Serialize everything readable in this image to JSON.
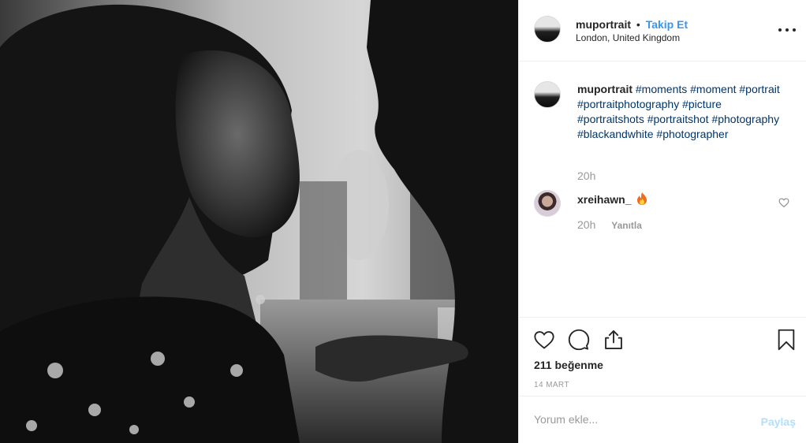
{
  "post": {
    "username": "muportrait",
    "separator": "•",
    "follow_label": "Takip Et",
    "location": "London, United Kingdom",
    "more_options_icon": "more-horizontal-icon"
  },
  "photo": {
    "description_icon": "photo"
  },
  "caption": {
    "username": "muportrait",
    "hashtags": [
      "#moments",
      "#moment",
      "#portrait",
      "#portraitphotography",
      "#picture",
      "#portraitshots",
      "#portraitshot",
      "#photography",
      "#blackandwhite",
      "#photographer"
    ],
    "time": "20h"
  },
  "comments": [
    {
      "username": "xreihawn_",
      "emoji": "fire",
      "time": "20h",
      "reply_label": "Yanıtla"
    }
  ],
  "actions": {
    "like_icon": "heart-icon",
    "comment_icon": "comment-icon",
    "share_icon": "share-icon",
    "save_icon": "bookmark-icon"
  },
  "likes": "211 beğenme",
  "date": "14 MART",
  "add_comment": {
    "placeholder": "Yorum ekle...",
    "post_label": "Paylaş"
  },
  "colors": {
    "link": "#3897f0",
    "hashtag": "#003569",
    "muted": "#999999",
    "post_disabled": "#b2dffc"
  }
}
